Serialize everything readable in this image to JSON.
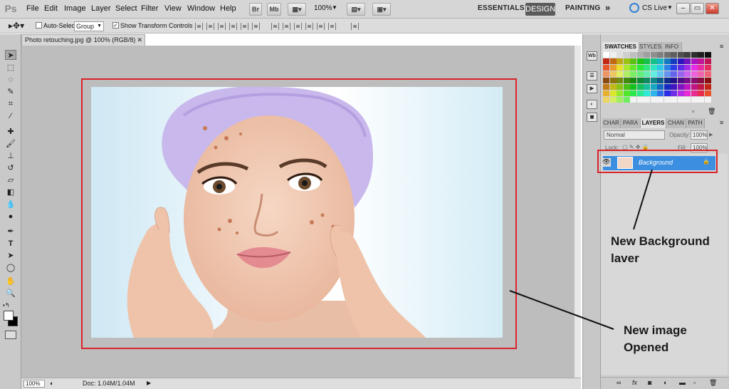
{
  "app": {
    "logo": "Ps"
  },
  "menu": [
    "File",
    "Edit",
    "Image",
    "Layer",
    "Select",
    "Filter",
    "View",
    "Window",
    "Help"
  ],
  "toolbar_buttons": {
    "bridge": "Br",
    "minibridge": "Mb"
  },
  "zoom": "100%",
  "workspaces": {
    "essentials": "ESSENTIALS",
    "design": "DESIGN",
    "painting": "PAINTING",
    "more": "»"
  },
  "cslive": "CS Live",
  "window_controls": {
    "minimize": "–",
    "restore": "▭",
    "close": "✕"
  },
  "options": {
    "auto_select_label": "Auto-Select:",
    "auto_select_value": "Group",
    "show_transform_label": "Show Transform Controls"
  },
  "document": {
    "tab_title": "Photo retouching.jpg @ 100% (RGB/8)",
    "tab_close": "✕"
  },
  "status": {
    "zoom": "100%",
    "doc_info": "Doc: 1.04M/1.04M"
  },
  "panels": {
    "top_tabs": [
      "SWATCHES",
      "STYLES",
      "INFO"
    ],
    "bottom_tabs": [
      "CHAR",
      "PARA",
      "LAYERS",
      "CHAN",
      "PATH"
    ],
    "blend_mode": "Normal",
    "opacity_label": "Opacity:",
    "opacity_value": "100%",
    "lock_label": "Lock:",
    "fill_label": "Fill:",
    "fill_value": "100%"
  },
  "layer": {
    "name": "Background"
  },
  "annotations": {
    "layer_line1": "New Background",
    "layer_line2": "laver",
    "image_line1": "New image",
    "image_line2": "Opened"
  },
  "colors": {
    "highlight": "#d9232b",
    "selected_layer": "#3c8fe0",
    "canvas_bg": "#bdbdbd"
  }
}
